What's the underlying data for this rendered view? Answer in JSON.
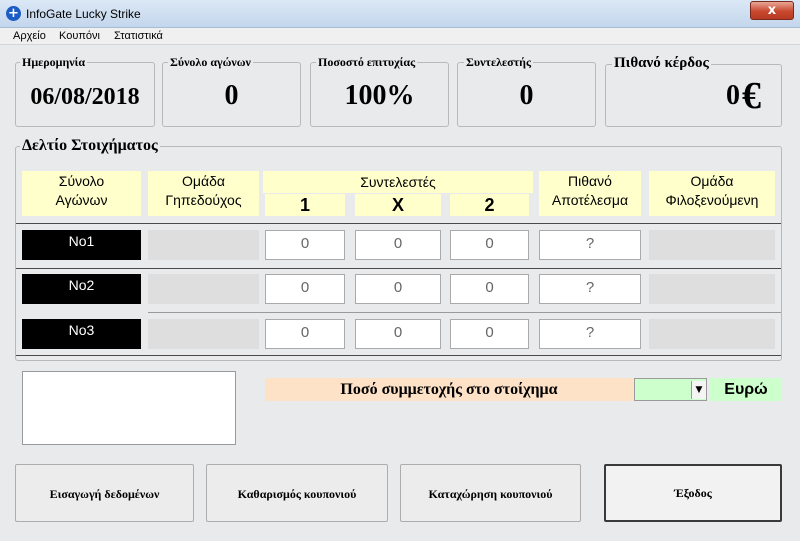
{
  "window": {
    "title": "InfoGate Lucky Strike",
    "close_glyph": "x"
  },
  "menu": [
    "Αρχείο",
    "Κουπόνι",
    "Στατιστικά"
  ],
  "stats": {
    "date": {
      "label": "Ημερομηνία",
      "value": "06/08/2018"
    },
    "total_matches": {
      "label": "Σύνολο αγώνων",
      "value": "0"
    },
    "success_rate": {
      "label": "Ποσοστό επιτυχίας",
      "value": "100%"
    },
    "coefficient": {
      "label": "Συντελεστής",
      "value": "0"
    },
    "potential_profit": {
      "label": "Πιθανό κέρδος",
      "value": "0",
      "currency": "€"
    }
  },
  "coupon": {
    "title": "Δελτίο Στοιχήματος",
    "headers": {
      "total_line1": "Σύνολο",
      "total_line2": "Αγώνων",
      "home_line1": "Ομάδα",
      "home_line2": "Γηπεδούχος",
      "odds_title": "Συντελεστές",
      "odd1": "1",
      "oddx": "X",
      "odd2": "2",
      "result_line1": "Πιθανό",
      "result_line2": "Αποτέλεσμα",
      "away_line1": "Ομάδα",
      "away_line2": "Φιλοξενούμενη"
    },
    "rows": [
      {
        "label": "No1",
        "odd1": "0",
        "oddx": "0",
        "odd2": "0",
        "result": "?"
      },
      {
        "label": "No2",
        "odd1": "0",
        "oddx": "0",
        "odd2": "0",
        "result": "?"
      },
      {
        "label": "No3",
        "odd1": "0",
        "oddx": "0",
        "odd2": "0",
        "result": "?"
      }
    ]
  },
  "stake": {
    "label": "Ποσό συμμετοχής στο στοίχημα",
    "currency": "Ευρώ",
    "value": ""
  },
  "buttons": {
    "enter": "Εισαγωγή δεδομένων",
    "clear": "Καθαρισμός κουπονιού",
    "save": "Καταχώρηση κουπονιού",
    "exit": "Έξοδος"
  },
  "colors": {
    "header_bg": "#ffffcc",
    "stake_label_bg": "#fde2c8",
    "stake_input_bg": "#ccffcc",
    "currency_bg": "#ccffcc"
  }
}
